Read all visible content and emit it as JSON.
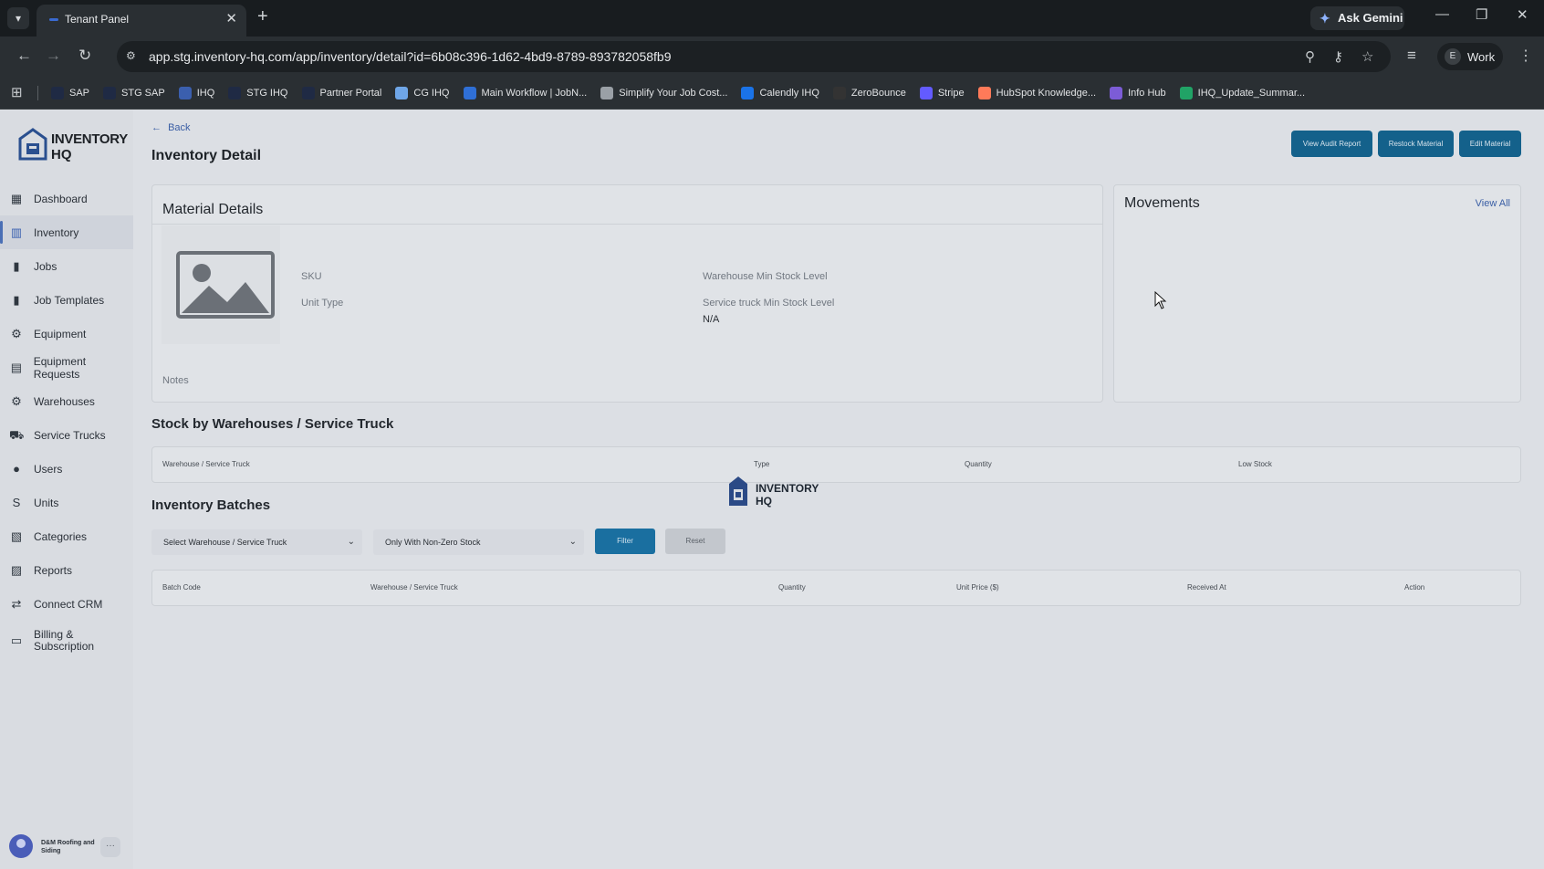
{
  "browser": {
    "tab_title": "Tenant Panel",
    "url": "app.stg.inventory-hq.com/app/inventory/detail?id=6b08c396-1d62-4bd9-8789-893782058fb9",
    "gemini_label": "Ask Gemini",
    "profile_initial": "E",
    "profile_label": "Work",
    "bookmarks": [
      {
        "label": "SAP",
        "color": "#1f2a44"
      },
      {
        "label": "STG SAP",
        "color": "#1f2a44"
      },
      {
        "label": "IHQ",
        "color": "#3b5fae"
      },
      {
        "label": "STG IHQ",
        "color": "#1f2a44"
      },
      {
        "label": "Partner Portal",
        "color": "#1f2a44"
      },
      {
        "label": "CG IHQ",
        "color": "#6fa6e8"
      },
      {
        "label": "Main Workflow | JobN...",
        "color": "#2f6fd6"
      },
      {
        "label": "Simplify Your Job Cost...",
        "color": "#9aa0a6"
      },
      {
        "label": "Calendly IHQ",
        "color": "#1a73e8"
      },
      {
        "label": "ZeroBounce",
        "color": "#333333"
      },
      {
        "label": "Stripe",
        "color": "#635bff"
      },
      {
        "label": "HubSpot Knowledge...",
        "color": "#ff7a59"
      },
      {
        "label": "Info Hub",
        "color": "#7c5cd6"
      },
      {
        "label": "IHQ_Update_Summar...",
        "color": "#21a366"
      }
    ]
  },
  "sidebar": {
    "logo_line1": "INVENTORY",
    "logo_line2": "HQ",
    "items": [
      {
        "label": "Dashboard",
        "icon": "▦"
      },
      {
        "label": "Inventory",
        "icon": "▥"
      },
      {
        "label": "Jobs",
        "icon": "▮"
      },
      {
        "label": "Job Templates",
        "icon": "▮"
      },
      {
        "label": "Equipment",
        "icon": "⚙"
      },
      {
        "label": "Equipment Requests",
        "icon": "▤"
      },
      {
        "label": "Warehouses",
        "icon": "⚙"
      },
      {
        "label": "Service Trucks",
        "icon": "⛟"
      },
      {
        "label": "Users",
        "icon": "●"
      },
      {
        "label": "Units",
        "icon": "S"
      },
      {
        "label": "Categories",
        "icon": "▧"
      },
      {
        "label": "Reports",
        "icon": "▨"
      },
      {
        "label": "Connect CRM",
        "icon": "⇄"
      },
      {
        "label": "Billing & Subscription",
        "icon": "▭"
      }
    ],
    "company_name": "D&M Roofing and Siding",
    "company_more": "···"
  },
  "page": {
    "back_label": "Back",
    "title": "Inventory Detail",
    "buttons": {
      "audit": "View Audit Report",
      "restock": "Restock Material",
      "edit": "Edit Material"
    },
    "material_details": {
      "title": "Material Details",
      "sku_label": "SKU",
      "unit_type_label": "Unit Type",
      "warehouse_min_label": "Warehouse Min Stock Level",
      "truck_min_label": "Service truck Min Stock Level",
      "truck_min_value": "N/A",
      "notes_label": "Notes"
    },
    "movements": {
      "title": "Movements",
      "view_all": "View All"
    },
    "stock": {
      "title": "Stock by Warehouses / Service Truck",
      "columns": [
        "Warehouse / Service Truck",
        "Type",
        "Quantity",
        "Low Stock"
      ]
    },
    "batches": {
      "title": "Inventory Batches",
      "warehouse_select": "Select Warehouse / Service Truck",
      "stock_select": "Only With Non-Zero Stock",
      "filter_label": "Filter",
      "reset_label": "Reset",
      "columns": [
        "Batch Code",
        "Warehouse / Service Truck",
        "Quantity",
        "Unit Price ($)",
        "Received At",
        "Action"
      ]
    },
    "overlay_logo_line1": "INVENTORY",
    "overlay_logo_line2": "HQ"
  }
}
